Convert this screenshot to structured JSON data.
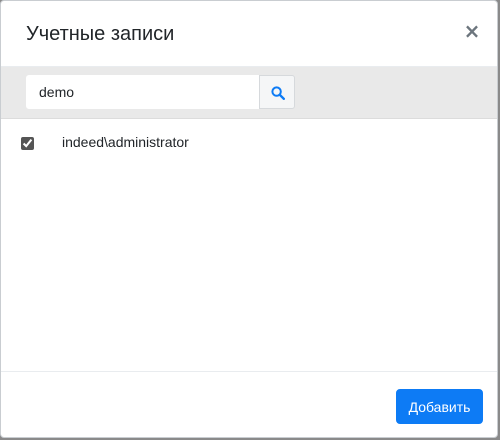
{
  "dialog": {
    "title": "Учетные записи",
    "close_label": "×"
  },
  "search": {
    "value": "demo",
    "placeholder": "",
    "icon": "search-icon"
  },
  "accounts": [
    {
      "label": "indeed\\administrator",
      "checked": true
    }
  ],
  "footer": {
    "add_label": "Добавить"
  },
  "colors": {
    "accent": "#0d7bf5",
    "search_bar_bg": "#e9e9e9"
  }
}
